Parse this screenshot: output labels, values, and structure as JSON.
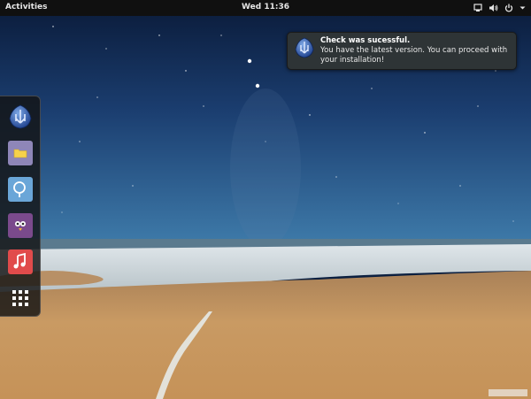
{
  "topbar": {
    "activities_label": "Activities",
    "clock": "Wed 11:36",
    "icons": [
      "network-icon",
      "volume-icon",
      "power-icon",
      "chevron-down-icon"
    ]
  },
  "notification": {
    "title": "Check was sucessful.",
    "body": "You have the latest version. You can proceed with your installation!",
    "icon": "app-icon"
  },
  "dash": {
    "items": [
      {
        "name": "installer-icon"
      },
      {
        "name": "files-icon"
      },
      {
        "name": "web-browser-icon"
      },
      {
        "name": "chat-icon"
      },
      {
        "name": "music-icon"
      },
      {
        "name": "show-applications-icon"
      }
    ]
  },
  "colors": {
    "topbar": "#101010",
    "sky_top": "#0b1f3f",
    "sky_horizon": "#3d78a7",
    "sand": "#c99a63",
    "notification_bg": "#2e3436"
  }
}
